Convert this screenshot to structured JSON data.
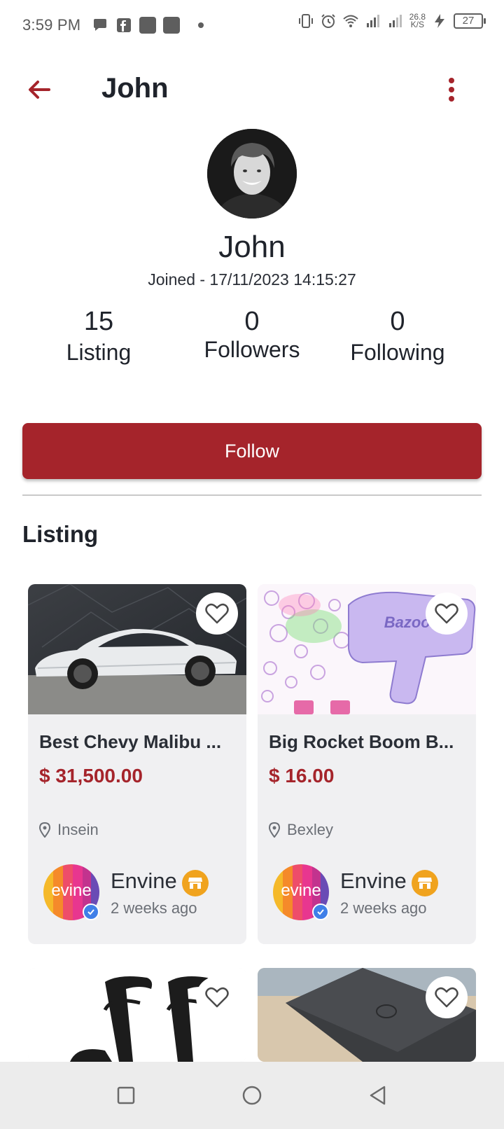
{
  "status_bar": {
    "time": "3:59 PM",
    "net_speed_value": "26.8",
    "net_speed_unit": "K/S",
    "battery": "27",
    "icons": [
      "chat-bubble-icon",
      "facebook-icon",
      "app-icon",
      "app-icon",
      "dot-icon",
      "vibrate-icon",
      "alarm-icon",
      "wifi-icon",
      "signal-icon",
      "signal-icon",
      "charging-icon",
      "battery-icon"
    ]
  },
  "header": {
    "title": "John"
  },
  "profile": {
    "name": "John",
    "joined": "Joined - 17/11/2023 14:15:27"
  },
  "stats": [
    {
      "value": "15",
      "label": "Listing"
    },
    {
      "value": "0",
      "label": "Followers"
    },
    {
      "value": "0",
      "label": "Following"
    }
  ],
  "follow_label": "Follow",
  "listing_section_title": "Listing",
  "listings": [
    {
      "title": "Best Chevy Malibu ...",
      "price": "$ 31,500.00",
      "location": "Insein",
      "seller": "Envine",
      "seller_logo_text": "evine",
      "posted": "2 weeks ago"
    },
    {
      "title": "Big Rocket Boom B...",
      "price": "$ 16.00",
      "location": "Bexley",
      "seller": "Envine",
      "seller_logo_text": "evine",
      "posted": "2 weeks ago",
      "image_text": "Bazooka"
    },
    {
      "title": "",
      "price": "",
      "location": ""
    },
    {
      "title": "",
      "price": "",
      "location": ""
    }
  ],
  "colors": {
    "brand": "#a5242b",
    "text": "#1f232b",
    "muted": "#6b6f76",
    "card_bg": "#f0f0f2",
    "store_badge": "#f0a31e",
    "verified": "#3f7fe8"
  }
}
